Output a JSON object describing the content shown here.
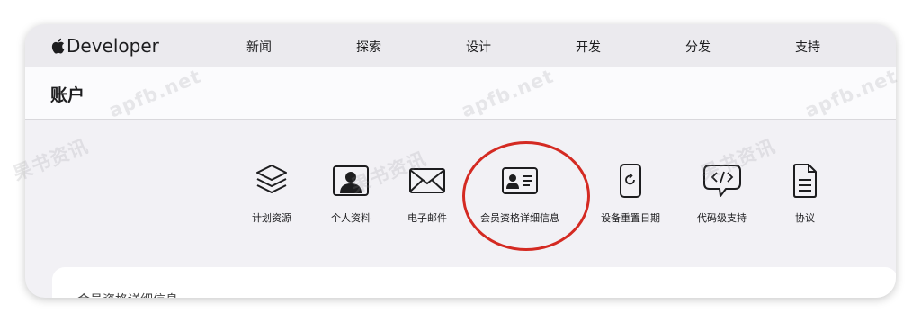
{
  "nav": {
    "logo_text": "Developer",
    "items": [
      "新闻",
      "探索",
      "设计",
      "开发",
      "分发",
      "支持"
    ]
  },
  "localnav": {
    "title": "账户"
  },
  "tiles": [
    {
      "label": "计划资源",
      "icon": "layers-icon"
    },
    {
      "label": "个人资料",
      "icon": "person-icon"
    },
    {
      "label": "电子邮件",
      "icon": "envelope-icon"
    },
    {
      "label": "会员资格详细信息",
      "icon": "id-card-icon"
    },
    {
      "label": "设备重置日期",
      "icon": "device-reset-icon"
    },
    {
      "label": "代码级支持",
      "icon": "code-bubble-icon"
    },
    {
      "label": "协议",
      "icon": "document-icon"
    }
  ],
  "highlight": {
    "target": "会员资格详细信息",
    "color": "#d42a22"
  },
  "card": {
    "partial_text": "会员资格详细信息"
  },
  "watermark": {
    "site": "apfb.net",
    "brand": "果书资讯"
  }
}
